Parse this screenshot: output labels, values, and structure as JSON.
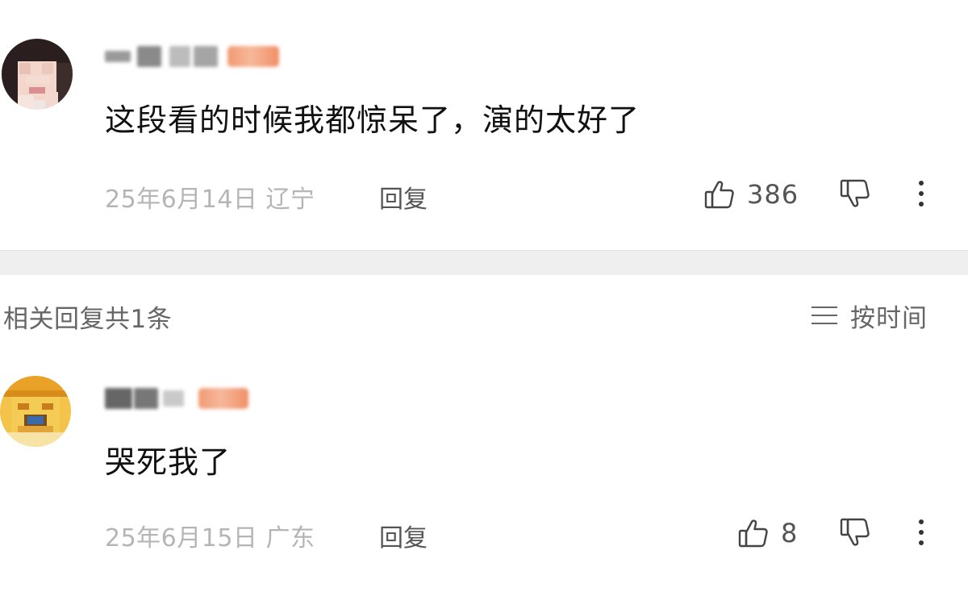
{
  "comments": [
    {
      "text": "这段看的时候我都惊呆了，演的太好了",
      "date_location": "25年6月14日 辽宁",
      "reply_label": "回复",
      "like_count": "386",
      "icons": {
        "like": "thumbs-up-icon",
        "dislike": "thumbs-down-icon",
        "more": "more-vertical-icon"
      }
    }
  ],
  "related_replies": {
    "title": "相关回复共1条",
    "sort_label": "按时间",
    "sort_icon": "sort-lines-icon",
    "items": [
      {
        "text": "哭死我了",
        "date_location": "25年6月15日 广东",
        "reply_label": "回复",
        "like_count": "8",
        "icons": {
          "like": "thumbs-up-icon",
          "dislike": "thumbs-down-icon",
          "more": "more-vertical-icon"
        }
      }
    ]
  },
  "colors": {
    "meta_text": "#b5b5b5",
    "secondary_text": "#666666",
    "primary_text": "#111111",
    "divider": "#efefef",
    "badge": "#f29a73"
  }
}
